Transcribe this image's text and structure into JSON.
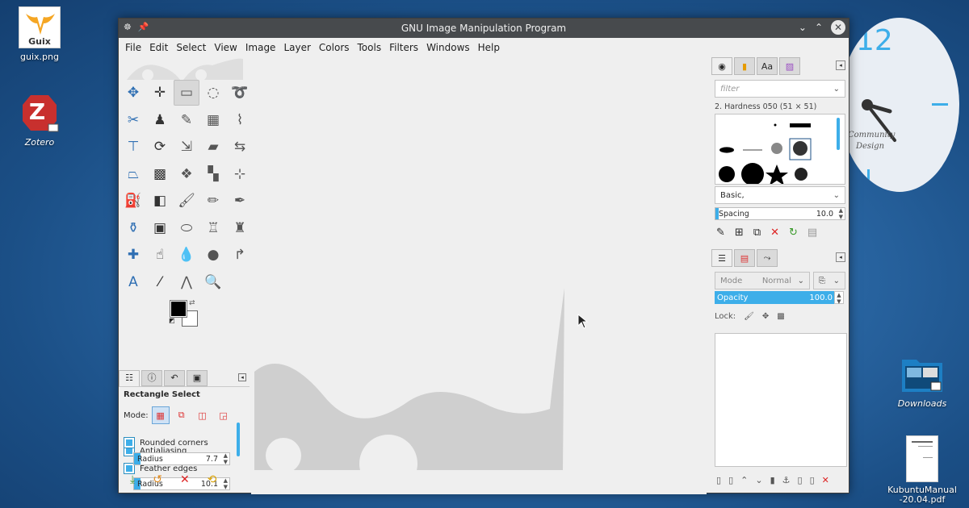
{
  "desktop": {
    "icons": [
      {
        "label": "guix.png",
        "logo_text": "Guix"
      },
      {
        "label": "Zotero",
        "logo_text": "Z"
      },
      {
        "label": "Downloads"
      },
      {
        "label": "KubuntuManual\n-20.04.pdf"
      }
    ],
    "clock": {
      "hour_mark": "12",
      "brand_line1": "Community",
      "brand_line2": "Design"
    }
  },
  "window": {
    "title": "GNU Image Manipulation Program",
    "menu": [
      "File",
      "Edit",
      "Select",
      "View",
      "Image",
      "Layer",
      "Colors",
      "Tools",
      "Filters",
      "Windows",
      "Help"
    ]
  },
  "toolbox": {
    "tools": [
      {
        "name": "unified-transform-tool",
        "glyph": "✥"
      },
      {
        "name": "move-tool",
        "glyph": "✛"
      },
      {
        "name": "rectangle-select-tool",
        "glyph": "▭",
        "selected": true
      },
      {
        "name": "ellipse-select-tool",
        "glyph": "◌"
      },
      {
        "name": "free-select-tool",
        "glyph": "➰"
      },
      {
        "name": "scissors-select-tool",
        "glyph": "✂"
      },
      {
        "name": "foreground-select-tool",
        "glyph": "♟"
      },
      {
        "name": "fuzzy-select-tool",
        "glyph": "✎"
      },
      {
        "name": "select-by-color-tool",
        "glyph": "▦"
      },
      {
        "name": "paths-tool",
        "glyph": "⌇"
      },
      {
        "name": "align-tool",
        "glyph": "⊤"
      },
      {
        "name": "rotate-tool",
        "glyph": "⟳"
      },
      {
        "name": "scale-tool",
        "glyph": "⇲"
      },
      {
        "name": "shear-tool",
        "glyph": "▰"
      },
      {
        "name": "flip-tool",
        "glyph": "⇆"
      },
      {
        "name": "perspective-tool",
        "glyph": "⏢"
      },
      {
        "name": "3d-transform-tool",
        "glyph": "▩"
      },
      {
        "name": "handle-transform-tool",
        "glyph": "❖"
      },
      {
        "name": "warp-transform-tool",
        "glyph": "▚"
      },
      {
        "name": "cage-transform-tool",
        "glyph": "⊹"
      },
      {
        "name": "bucket-fill-tool",
        "glyph": "⛽"
      },
      {
        "name": "gradient-tool",
        "glyph": "◧"
      },
      {
        "name": "paintbrush-tool",
        "glyph": "🖌"
      },
      {
        "name": "pencil-tool",
        "glyph": "✏"
      },
      {
        "name": "airbrush-tool",
        "glyph": "✒"
      },
      {
        "name": "ink-tool",
        "glyph": "⚱"
      },
      {
        "name": "mypaint-brush-tool",
        "glyph": "▣"
      },
      {
        "name": "eraser-tool",
        "glyph": "⬭"
      },
      {
        "name": "clone-tool",
        "glyph": "♖"
      },
      {
        "name": "perspective-clone-tool",
        "glyph": "♜"
      },
      {
        "name": "heal-tool",
        "glyph": "✚"
      },
      {
        "name": "smudge-tool",
        "glyph": "☝"
      },
      {
        "name": "blur-tool",
        "glyph": "💧"
      },
      {
        "name": "dodge-burn-tool",
        "glyph": "●"
      },
      {
        "name": "text-path-tool",
        "glyph": "↱"
      },
      {
        "name": "text-tool",
        "glyph": "A"
      },
      {
        "name": "color-picker-tool",
        "glyph": "⁄"
      },
      {
        "name": "measure-tool",
        "glyph": "⋀"
      },
      {
        "name": "zoom-tool",
        "glyph": "🔍"
      }
    ],
    "colors": {
      "foreground": "#000000",
      "background": "#ffffff"
    }
  },
  "tool_options": {
    "title": "Rectangle Select",
    "mode_label": "Mode:",
    "antialiasing": "Antialiasing",
    "feather_edges": "Feather edges",
    "feather_radius": {
      "label": "Radius",
      "value": "10.1"
    },
    "rounded_corners": "Rounded corners",
    "rounded_radius": {
      "label": "Radius",
      "value": "7.7"
    }
  },
  "brushes_dock": {
    "filter_placeholder": "filter",
    "brush_name": "2. Hardness 050 (51 × 51)",
    "tag_value": "Basic,",
    "spacing": {
      "label": "Spacing",
      "value": "10.0"
    }
  },
  "layers_dock": {
    "mode_label": "Mode",
    "mode_value": "Normal",
    "opacity": {
      "label": "Opacity",
      "value": "100.0"
    },
    "lock_label": "Lock:"
  },
  "accent_color": "#3daee9"
}
